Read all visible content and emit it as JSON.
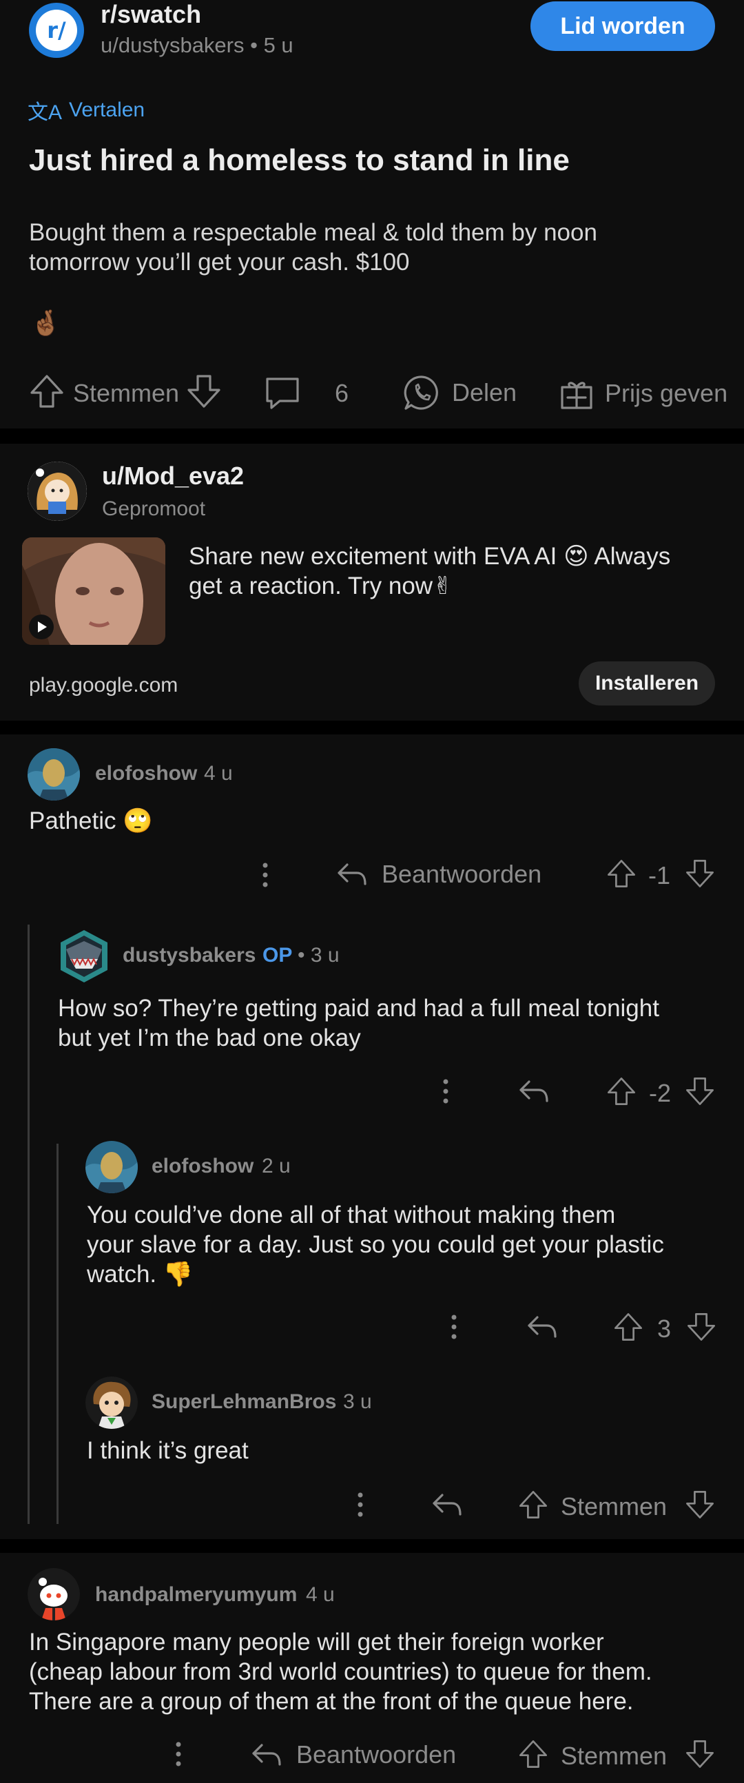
{
  "post": {
    "subreddit": "r/swatch",
    "subreddit_icon_text": "r/",
    "author_time": "u/dustysbakers • 5 u",
    "join_label": "Lid worden",
    "translate_label": "Vertalen",
    "title": "Just hired a homeless to stand in line",
    "body_line1": "Bought them a respectable meal & told them by noon",
    "body_line2": "tomorrow you’ll get your cash.  $100",
    "emoji": "🤞🏾",
    "vote_label": "Stemmen",
    "comment_count": "6",
    "share_label": "Delen",
    "award_label": "Prijs geven"
  },
  "ad": {
    "username": "u/Mod_eva2",
    "promoted_label": "Gepromoot",
    "text_line1": "Share new excitement with EVA AI 😍 Always",
    "text_line2": "get a reaction. Try now✌",
    "domain": "play.google.com",
    "install_label": "Installeren"
  },
  "comments": [
    {
      "username": "elofoshow",
      "time": "4 u",
      "body": [
        "Pathetic 🙄"
      ],
      "reply_label": "Beantwoorden",
      "score": "-1"
    },
    {
      "username": "dustysbakers",
      "op_badge": "OP",
      "time": "• 3 u",
      "body": [
        "How so? They’re getting paid and had a full meal tonight",
        "but yet I’m the bad one okay"
      ],
      "score": "-2"
    },
    {
      "username": "elofoshow",
      "time": "2 u",
      "body": [
        "You could’ve done all of that without making them",
        "your slave for a day. Just so you could get your plastic",
        "watch. 👎"
      ],
      "score": "3"
    },
    {
      "username": "SuperLehmanBros",
      "time": "3 u",
      "body": [
        "I think it’s great"
      ],
      "score": "Stemmen"
    },
    {
      "username": "handpalmeryumyum",
      "time": "4 u",
      "body": [
        "In Singapore many people will get their foreign worker",
        "(cheap labour from 3rd world countries) to queue for them.",
        "There are a group of them at the front of the queue here."
      ],
      "reply_label": "Beantwoorden",
      "score": "Stemmen"
    }
  ]
}
